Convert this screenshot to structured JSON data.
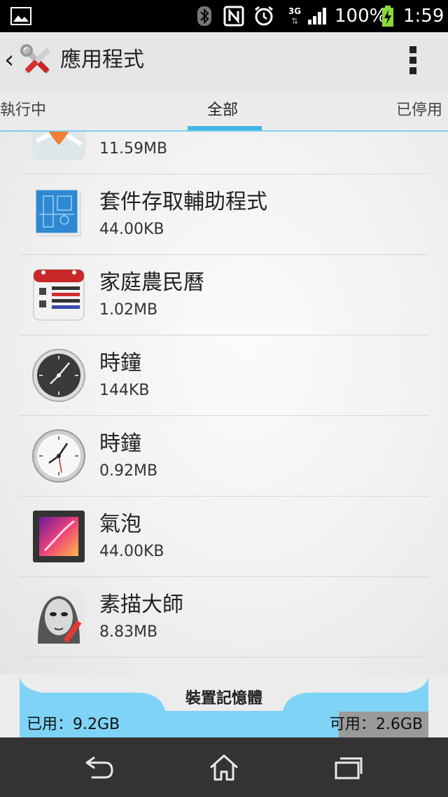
{
  "status_bar": {
    "network": "3G",
    "battery": "100%",
    "time": "1:59",
    "icons": [
      "gallery-icon",
      "bluetooth-icon",
      "nfc-icon",
      "alarm-icon",
      "signal-icon",
      "battery-charging-icon"
    ]
  },
  "action_bar": {
    "title": "應用程式",
    "icon": "settings-tools-icon"
  },
  "tabs": [
    {
      "label": "執行中"
    },
    {
      "label": "全部",
      "active": true
    },
    {
      "label": "已停用"
    }
  ],
  "apps": [
    {
      "name": "",
      "size": "11.59MB",
      "icon": "map-pin-icon"
    },
    {
      "name": "套件存取輔助程式",
      "size": "44.00KB",
      "icon": "package-blueprint-icon"
    },
    {
      "name": "家庭農民曆",
      "size": "1.02MB",
      "icon": "calendar-icon"
    },
    {
      "name": "時鐘",
      "size": "144KB",
      "icon": "dark-clock-icon"
    },
    {
      "name": "時鐘",
      "size": "0.92MB",
      "icon": "light-clock-icon"
    },
    {
      "name": "氣泡",
      "size": "44.00KB",
      "icon": "wallpaper-icon"
    },
    {
      "name": "素描大師",
      "size": "8.83MB",
      "icon": "sketch-portrait-icon"
    }
  ],
  "storage": {
    "label": "裝置記憶體",
    "used": "已用：9.2GB",
    "free": "可用：2.6GB",
    "used_fraction": 0.78
  },
  "nav": {
    "icons": [
      "back-icon",
      "home-icon",
      "recents-icon"
    ]
  }
}
